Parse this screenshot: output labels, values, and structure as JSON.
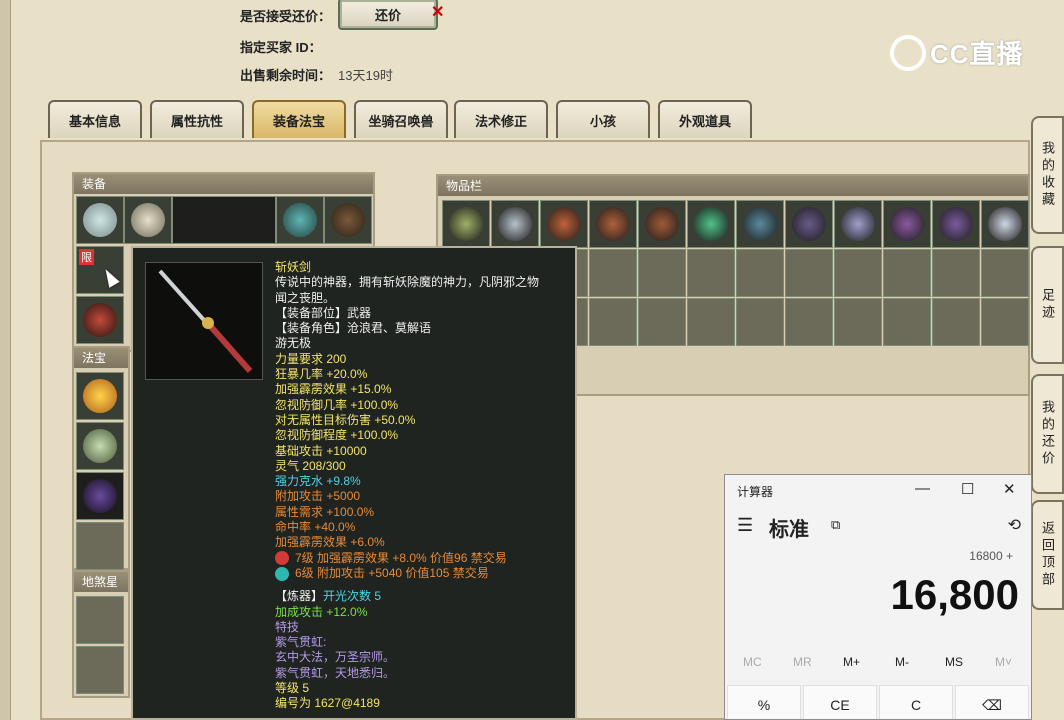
{
  "header": {
    "accept_counter_label": "是否接受还价：",
    "counter_button": "还价",
    "buyer_label": "指定买家 ID：",
    "time_label": "出售剩余时间：",
    "time_value": "13天19时",
    "logo_text": "CC直播"
  },
  "tabs": [
    "基本信息",
    "属性抗性",
    "装备法宝",
    "坐骑召唤兽",
    "法术修正",
    "小孩",
    "外观道具"
  ],
  "active_tab": "装备法宝",
  "groups": {
    "equipment": "装备",
    "treasure": "法宝",
    "star": "地煞星局",
    "inventory": "物品栏"
  },
  "limit_badge": "限",
  "tooltip": {
    "lines": [
      {
        "t": "斩妖剑",
        "c": "c-y"
      },
      {
        "t": "传说中的神器，拥有斩妖除魔的神力，凡阴邪之物",
        "c": "c-w"
      },
      {
        "t": "闻之丧胆。",
        "c": "c-w"
      },
      {
        "t": "【装备部位】武器",
        "c": "c-w"
      },
      {
        "t": "【装备角色】沧浪君、莫解语",
        "c": "c-w"
      },
      {
        "t": "游无极",
        "c": "c-w"
      },
      {
        "t": "力量要求 200",
        "c": "c-y"
      },
      {
        "t": "狂暴几率 +20.0%",
        "c": "c-y"
      },
      {
        "t": "加强霹雳效果 +15.0%",
        "c": "c-y"
      },
      {
        "t": "忽视防御几率 +100.0%",
        "c": "c-y"
      },
      {
        "t": "对无属性目标伤害 +50.0%",
        "c": "c-y"
      },
      {
        "t": "忽视防御程度 +100.0%",
        "c": "c-y"
      },
      {
        "t": "基础攻击 +10000",
        "c": "c-y"
      },
      {
        "t": "灵气 208/300",
        "c": "c-y"
      },
      {
        "t": "强力克水 +9.8%",
        "c": "c-c"
      },
      {
        "t": "附加攻击 +5000",
        "c": "c-o"
      },
      {
        "t": "属性需求 +100.0%",
        "c": "c-o"
      },
      {
        "t": "命中率 +40.0%",
        "c": "c-o"
      },
      {
        "t": "加强霹雳效果 +6.0%",
        "c": "c-o"
      }
    ],
    "gems": [
      {
        "t": "7级 加强霹雳效果 +8.0% 价值96 禁交易",
        "color": "#d43a3a"
      },
      {
        "t": "6级 附加攻击 +5040 价值105 禁交易",
        "color": "#2fb6b0"
      }
    ],
    "refine_label": "【炼器】",
    "refine_value": "开光次数 5",
    "lines2": [
      {
        "t": "加成攻击 +12.0%",
        "c": "c-g"
      },
      {
        "t": "特技",
        "c": "c-p"
      },
      {
        "t": "紫气贯虹:",
        "c": "c-p"
      },
      {
        "t": "玄中大法，万圣宗师。",
        "c": "c-p"
      },
      {
        "t": "紫气贯虹，天地悉归。",
        "c": "c-p"
      },
      {
        "t": "等级 5",
        "c": "c-y"
      },
      {
        "t": "编号为 1627@4189",
        "c": "c-y"
      }
    ]
  },
  "side_tabs": [
    "我的收藏",
    "足迹",
    "我的还价",
    "返回顶部"
  ],
  "calculator": {
    "title": "计算器",
    "mode": "标准",
    "expression": "16800 +",
    "display": "16,800",
    "memory": [
      "MC",
      "MR",
      "M+",
      "M-",
      "MS",
      "M˅"
    ],
    "keys": [
      "%",
      "CE",
      "C",
      "⌫"
    ]
  }
}
